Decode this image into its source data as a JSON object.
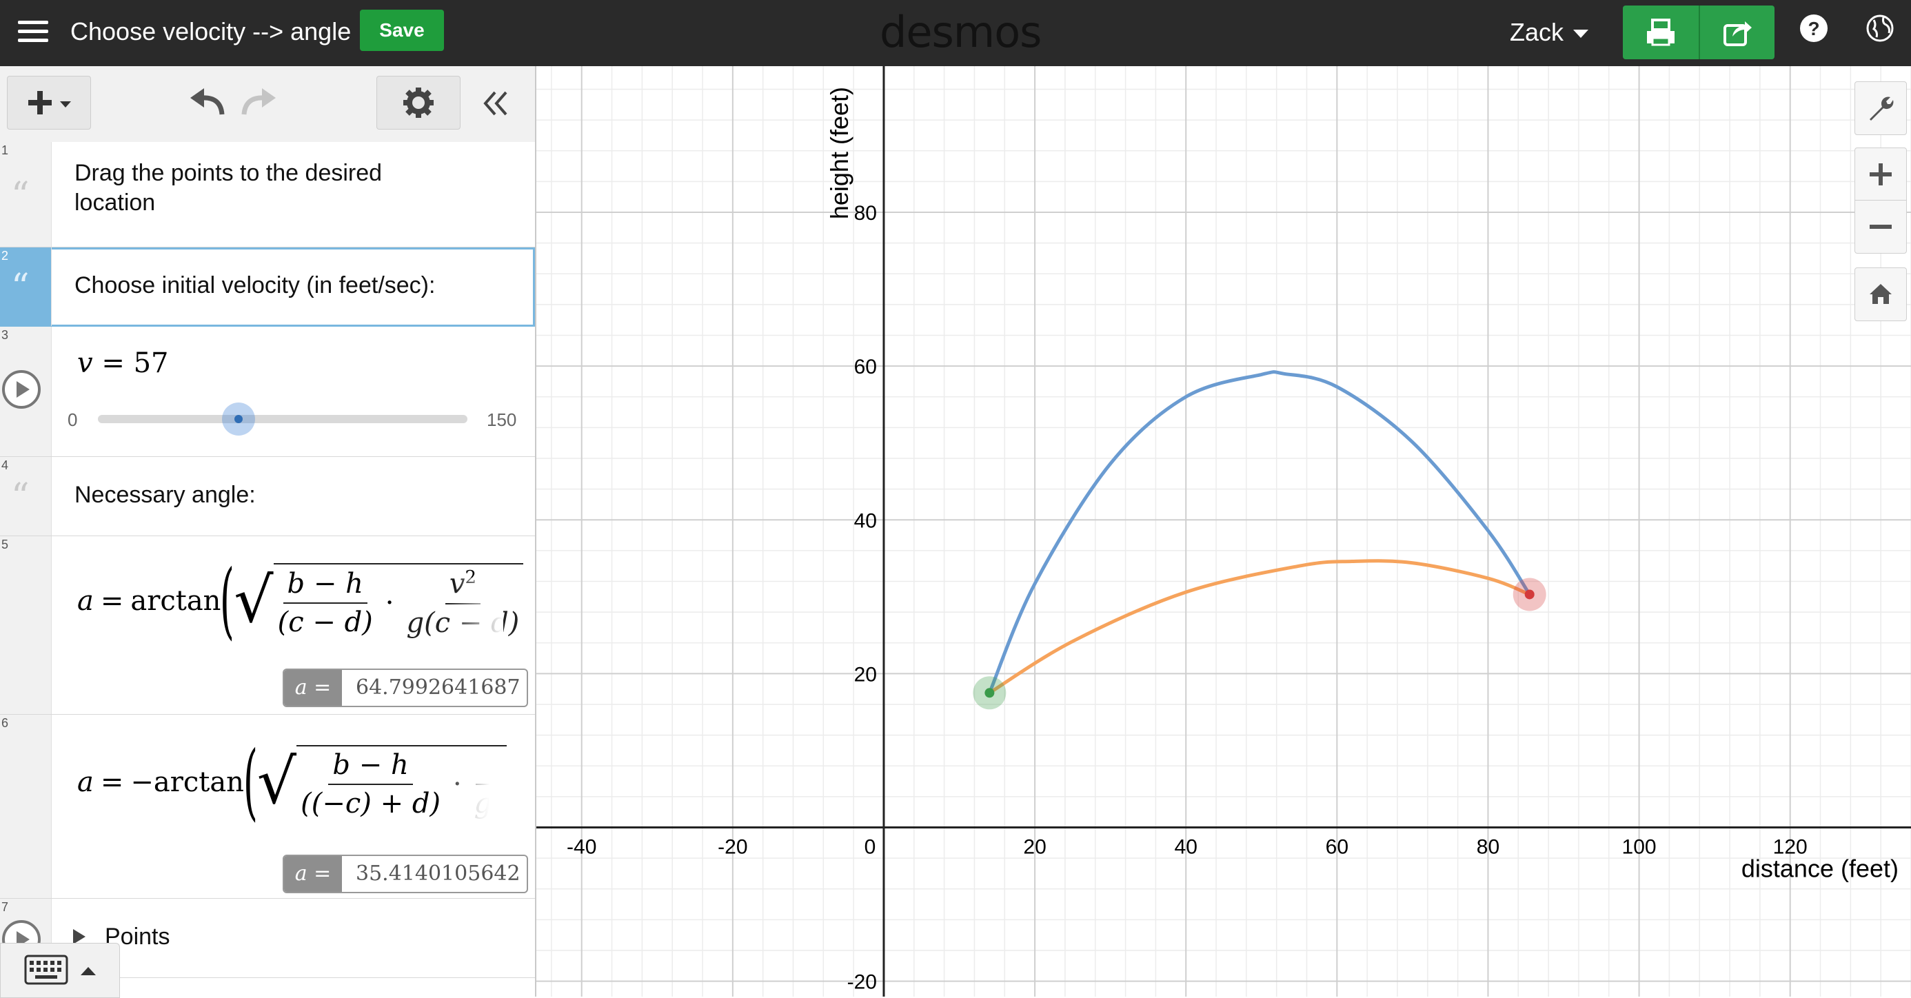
{
  "header": {
    "graph_title": "Choose velocity --> angle",
    "save_label": "Save",
    "logo": "desmos",
    "user_name": "Zack"
  },
  "toolbar": {
    "add_icon": "plus-icon",
    "undo_icon": "undo-icon",
    "redo_icon": "redo-icon",
    "settings_icon": "gear-icon",
    "collapse_icon": "double-chevron-left-icon"
  },
  "expressions": [
    {
      "index": "1",
      "type": "note",
      "text_line1": "Drag the points to the desired",
      "text_line2": "location"
    },
    {
      "index": "2",
      "type": "note",
      "text": "Choose initial velocity (in feet/sec):"
    },
    {
      "index": "3",
      "type": "slider",
      "variable": "v",
      "equals": "=",
      "value": "57",
      "min": "0",
      "max": "150"
    },
    {
      "index": "4",
      "type": "note",
      "text": "Necessary angle:"
    },
    {
      "index": "5",
      "type": "expression",
      "lhs": "a",
      "op": "=",
      "fn": "arctan",
      "num1": "b − h",
      "den1": "(c − d)",
      "dot": "·",
      "num2": "v",
      "num2_exp": "2",
      "den2": "g(c − d)",
      "result_label": "a =",
      "result_value": "64.7992641687"
    },
    {
      "index": "6",
      "type": "expression",
      "lhs": "a",
      "op": "=",
      "fn": "−arctan",
      "num1": "b − h",
      "den1": "((−c) + d)",
      "dot": "·",
      "den2": "g(",
      "result_label": "a =",
      "result_value": "35.4140105642"
    },
    {
      "index": "7",
      "type": "folder",
      "label": "Points"
    }
  ],
  "chart_data": {
    "type": "line",
    "xlabel": "distance (feet)",
    "ylabel": "height (feet)",
    "xlim": [
      -46,
      136
    ],
    "ylim": [
      -22,
      99
    ],
    "x_ticks": [
      -40,
      -20,
      0,
      20,
      40,
      60,
      80,
      100,
      120
    ],
    "y_ticks": [
      -20,
      20,
      40,
      60,
      80
    ],
    "grid": true,
    "series": [
      {
        "color": "#6a9bd1",
        "points": [
          [
            14,
            17.5
          ],
          [
            20,
            31.7
          ],
          [
            30,
            47.3
          ],
          [
            40,
            56.0
          ],
          [
            50,
            58.9
          ],
          [
            53,
            59.0
          ],
          [
            60,
            57.3
          ],
          [
            70,
            50.1
          ],
          [
            80,
            38.6
          ],
          [
            85.5,
            30.3
          ]
        ]
      },
      {
        "color": "#f6a35c",
        "points": [
          [
            14,
            17.5
          ],
          [
            25,
            24.2
          ],
          [
            40,
            30.6
          ],
          [
            55,
            34.0
          ],
          [
            62,
            34.6
          ],
          [
            70,
            34.4
          ],
          [
            80,
            32.4
          ],
          [
            85.5,
            30.3
          ]
        ]
      }
    ],
    "points": [
      {
        "x": 14,
        "y": 17.5,
        "color": "#3a9a4a"
      },
      {
        "x": 85.5,
        "y": 30.3,
        "color": "#d33b3b"
      }
    ]
  },
  "graph_tools": [
    "wrench-icon",
    "zoom-in-icon",
    "zoom-out-icon",
    "home-icon"
  ]
}
